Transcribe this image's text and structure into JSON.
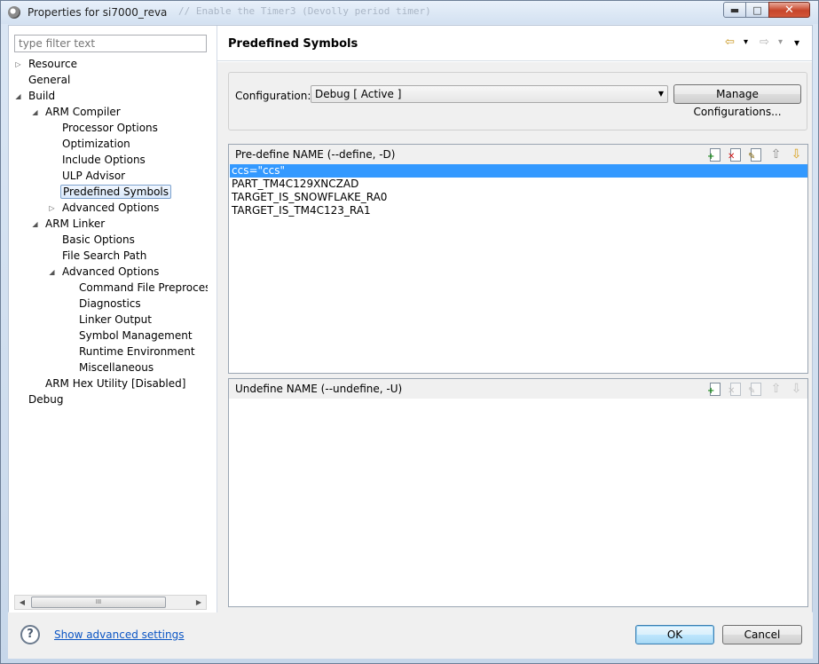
{
  "window": {
    "title": "Properties for si7000_reva",
    "ghost_text": "// Enable the Timer3 (Devolly period timer)",
    "min_glyph": "▬",
    "max_glyph": "□",
    "close_glyph": "✕"
  },
  "filter": {
    "placeholder": "type filter text"
  },
  "tree": [
    {
      "id": "resource",
      "label": "Resource",
      "depth": 0,
      "twisty": "collapsed"
    },
    {
      "id": "general",
      "label": "General",
      "depth": 0,
      "twisty": "none"
    },
    {
      "id": "build",
      "label": "Build",
      "depth": 0,
      "twisty": "expanded"
    },
    {
      "id": "arm-compiler",
      "label": "ARM Compiler",
      "depth": 1,
      "twisty": "expanded"
    },
    {
      "id": "processor-options",
      "label": "Processor Options",
      "depth": 2,
      "twisty": "none"
    },
    {
      "id": "optimization",
      "label": "Optimization",
      "depth": 2,
      "twisty": "none"
    },
    {
      "id": "include-options",
      "label": "Include Options",
      "depth": 2,
      "twisty": "none"
    },
    {
      "id": "ulp-advisor",
      "label": "ULP Advisor",
      "depth": 2,
      "twisty": "none"
    },
    {
      "id": "predefined-symbols",
      "label": "Predefined Symbols",
      "depth": 2,
      "twisty": "none",
      "selected": true
    },
    {
      "id": "advanced-options-compiler",
      "label": "Advanced Options",
      "depth": 2,
      "twisty": "collapsed"
    },
    {
      "id": "arm-linker",
      "label": "ARM Linker",
      "depth": 1,
      "twisty": "expanded"
    },
    {
      "id": "basic-options",
      "label": "Basic Options",
      "depth": 2,
      "twisty": "none"
    },
    {
      "id": "file-search-path",
      "label": "File Search Path",
      "depth": 2,
      "twisty": "none"
    },
    {
      "id": "advanced-options-linker",
      "label": "Advanced Options",
      "depth": 2,
      "twisty": "expanded"
    },
    {
      "id": "command-file-preprocessing",
      "label": "Command File Preprocessing",
      "depth": 3,
      "twisty": "none"
    },
    {
      "id": "diagnostics",
      "label": "Diagnostics",
      "depth": 3,
      "twisty": "none"
    },
    {
      "id": "linker-output",
      "label": "Linker Output",
      "depth": 3,
      "twisty": "none"
    },
    {
      "id": "symbol-management",
      "label": "Symbol Management",
      "depth": 3,
      "twisty": "none"
    },
    {
      "id": "runtime-environment",
      "label": "Runtime Environment",
      "depth": 3,
      "twisty": "none"
    },
    {
      "id": "miscellaneous",
      "label": "Miscellaneous",
      "depth": 3,
      "twisty": "none"
    },
    {
      "id": "arm-hex-utility",
      "label": "ARM Hex Utility  [Disabled]",
      "depth": 1,
      "twisty": "none"
    },
    {
      "id": "debug",
      "label": "Debug",
      "depth": 0,
      "twisty": "none"
    }
  ],
  "scroll": {
    "left": "◀",
    "right": "▶",
    "grip": "III"
  },
  "page": {
    "title": "Predefined Symbols",
    "nav_back": "⇦",
    "nav_back_menu": "▾",
    "nav_forward": "⇨",
    "nav_forward_menu": "▾",
    "view_menu": "▾"
  },
  "configuration": {
    "label": "Configuration:",
    "value": "Debug  [ Active ]",
    "dropdown_glyph": "▼",
    "manage_label": "Manage Configurations..."
  },
  "predefine": {
    "label": "Pre-define NAME (--define, -D)",
    "items": [
      "ccs=\"ccs\"",
      "PART_TM4C129XNCZAD",
      "TARGET_IS_SNOWFLAKE_RA0",
      "TARGET_IS_TM4C123_RA1"
    ],
    "selected_index": 0,
    "icons": {
      "add": "+",
      "delete": "✕",
      "edit": "✎",
      "up": "⇧",
      "down": "⇩"
    }
  },
  "undefine": {
    "label": "Undefine NAME (--undefine, -U)",
    "items": [],
    "icons": {
      "add": "+",
      "delete": "✕",
      "edit": "✎",
      "up": "⇧",
      "down": "⇩"
    }
  },
  "footer": {
    "help_glyph": "?",
    "advanced_link": "Show advanced settings",
    "ok_label": "OK",
    "cancel_label": "Cancel"
  },
  "colors": {
    "selection": "#3399ff",
    "link": "#0b55c4",
    "panel": "#f0f0f0"
  }
}
